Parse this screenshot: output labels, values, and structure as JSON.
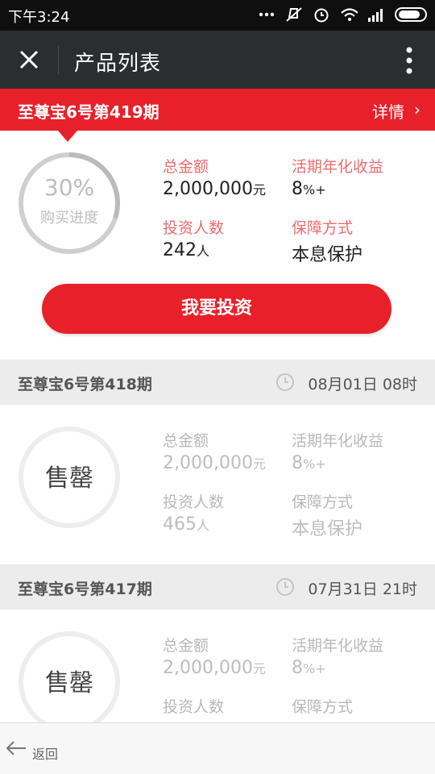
{
  "status_bar": {
    "time": "下午3:24"
  },
  "app_bar": {
    "title": "产品列表"
  },
  "products": [
    {
      "name": "至尊宝6号第419期",
      "detail_label": "详情",
      "progress_text": "30%",
      "progress_value": 0.3,
      "progress_label": "购买进度",
      "total_label": "总金额",
      "total_value": "2,000,000",
      "total_unit": "元",
      "yield_label": "活期年化收益",
      "yield_value": "8",
      "yield_unit": "%+",
      "investors_label": "投资人数",
      "investors_value": "242",
      "investors_unit": "人",
      "guarantee_label": "保障方式",
      "guarantee_value": "本息保护",
      "button_label": "我要投资"
    },
    {
      "name": "至尊宝6号第418期",
      "datetime": "08月01日 08时",
      "status": "售罄",
      "total_label": "总金额",
      "total_value": "2,000,000",
      "total_unit": "元",
      "yield_label": "活期年化收益",
      "yield_value": "8",
      "yield_unit": "%+",
      "investors_label": "投资人数",
      "investors_value": "465",
      "investors_unit": "人",
      "guarantee_label": "保障方式",
      "guarantee_value": "本息保护"
    },
    {
      "name": "至尊宝6号第417期",
      "datetime": "07月31日 21时",
      "status": "售罄",
      "total_label": "总金额",
      "total_value": "2,000,000",
      "total_unit": "元",
      "yield_label": "活期年化收益",
      "yield_value": "8",
      "yield_unit": "%+",
      "investors_label": "投资人数",
      "guarantee_label": "保障方式"
    }
  ],
  "bottom_nav": {
    "back_label": "返回"
  },
  "colors": {
    "accent": "#e8202a",
    "appbar": "#2b2e30",
    "label_red": "#ef6b6f"
  }
}
